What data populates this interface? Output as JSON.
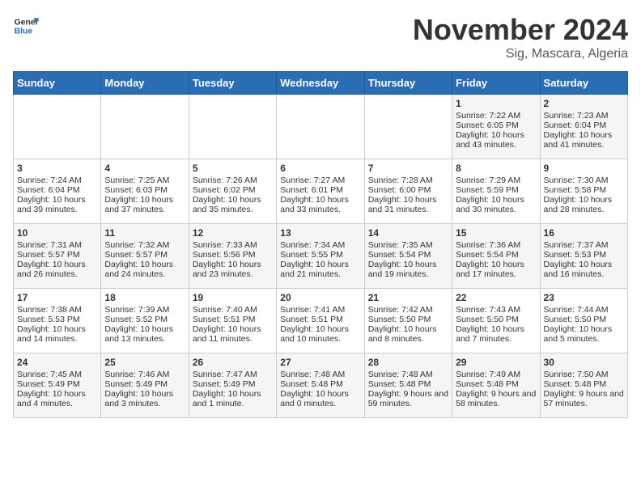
{
  "header": {
    "logo_general": "General",
    "logo_blue": "Blue",
    "month_title": "November 2024",
    "subtitle": "Sig, Mascara, Algeria"
  },
  "weekdays": [
    "Sunday",
    "Monday",
    "Tuesday",
    "Wednesday",
    "Thursday",
    "Friday",
    "Saturday"
  ],
  "weeks": [
    [
      {
        "day": "",
        "content": ""
      },
      {
        "day": "",
        "content": ""
      },
      {
        "day": "",
        "content": ""
      },
      {
        "day": "",
        "content": ""
      },
      {
        "day": "",
        "content": ""
      },
      {
        "day": "1",
        "content": "Sunrise: 7:22 AM\nSunset: 6:05 PM\nDaylight: 10 hours and 43 minutes."
      },
      {
        "day": "2",
        "content": "Sunrise: 7:23 AM\nSunset: 6:04 PM\nDaylight: 10 hours and 41 minutes."
      }
    ],
    [
      {
        "day": "3",
        "content": "Sunrise: 7:24 AM\nSunset: 6:04 PM\nDaylight: 10 hours and 39 minutes."
      },
      {
        "day": "4",
        "content": "Sunrise: 7:25 AM\nSunset: 6:03 PM\nDaylight: 10 hours and 37 minutes."
      },
      {
        "day": "5",
        "content": "Sunrise: 7:26 AM\nSunset: 6:02 PM\nDaylight: 10 hours and 35 minutes."
      },
      {
        "day": "6",
        "content": "Sunrise: 7:27 AM\nSunset: 6:01 PM\nDaylight: 10 hours and 33 minutes."
      },
      {
        "day": "7",
        "content": "Sunrise: 7:28 AM\nSunset: 6:00 PM\nDaylight: 10 hours and 31 minutes."
      },
      {
        "day": "8",
        "content": "Sunrise: 7:29 AM\nSunset: 5:59 PM\nDaylight: 10 hours and 30 minutes."
      },
      {
        "day": "9",
        "content": "Sunrise: 7:30 AM\nSunset: 5:58 PM\nDaylight: 10 hours and 28 minutes."
      }
    ],
    [
      {
        "day": "10",
        "content": "Sunrise: 7:31 AM\nSunset: 5:57 PM\nDaylight: 10 hours and 26 minutes."
      },
      {
        "day": "11",
        "content": "Sunrise: 7:32 AM\nSunset: 5:57 PM\nDaylight: 10 hours and 24 minutes."
      },
      {
        "day": "12",
        "content": "Sunrise: 7:33 AM\nSunset: 5:56 PM\nDaylight: 10 hours and 23 minutes."
      },
      {
        "day": "13",
        "content": "Sunrise: 7:34 AM\nSunset: 5:55 PM\nDaylight: 10 hours and 21 minutes."
      },
      {
        "day": "14",
        "content": "Sunrise: 7:35 AM\nSunset: 5:54 PM\nDaylight: 10 hours and 19 minutes."
      },
      {
        "day": "15",
        "content": "Sunrise: 7:36 AM\nSunset: 5:54 PM\nDaylight: 10 hours and 17 minutes."
      },
      {
        "day": "16",
        "content": "Sunrise: 7:37 AM\nSunset: 5:53 PM\nDaylight: 10 hours and 16 minutes."
      }
    ],
    [
      {
        "day": "17",
        "content": "Sunrise: 7:38 AM\nSunset: 5:53 PM\nDaylight: 10 hours and 14 minutes."
      },
      {
        "day": "18",
        "content": "Sunrise: 7:39 AM\nSunset: 5:52 PM\nDaylight: 10 hours and 13 minutes."
      },
      {
        "day": "19",
        "content": "Sunrise: 7:40 AM\nSunset: 5:51 PM\nDaylight: 10 hours and 11 minutes."
      },
      {
        "day": "20",
        "content": "Sunrise: 7:41 AM\nSunset: 5:51 PM\nDaylight: 10 hours and 10 minutes."
      },
      {
        "day": "21",
        "content": "Sunrise: 7:42 AM\nSunset: 5:50 PM\nDaylight: 10 hours and 8 minutes."
      },
      {
        "day": "22",
        "content": "Sunrise: 7:43 AM\nSunset: 5:50 PM\nDaylight: 10 hours and 7 minutes."
      },
      {
        "day": "23",
        "content": "Sunrise: 7:44 AM\nSunset: 5:50 PM\nDaylight: 10 hours and 5 minutes."
      }
    ],
    [
      {
        "day": "24",
        "content": "Sunrise: 7:45 AM\nSunset: 5:49 PM\nDaylight: 10 hours and 4 minutes."
      },
      {
        "day": "25",
        "content": "Sunrise: 7:46 AM\nSunset: 5:49 PM\nDaylight: 10 hours and 3 minutes."
      },
      {
        "day": "26",
        "content": "Sunrise: 7:47 AM\nSunset: 5:49 PM\nDaylight: 10 hours and 1 minute."
      },
      {
        "day": "27",
        "content": "Sunrise: 7:48 AM\nSunset: 5:48 PM\nDaylight: 10 hours and 0 minutes."
      },
      {
        "day": "28",
        "content": "Sunrise: 7:48 AM\nSunset: 5:48 PM\nDaylight: 9 hours and 59 minutes."
      },
      {
        "day": "29",
        "content": "Sunrise: 7:49 AM\nSunset: 5:48 PM\nDaylight: 9 hours and 58 minutes."
      },
      {
        "day": "30",
        "content": "Sunrise: 7:50 AM\nSunset: 5:48 PM\nDaylight: 9 hours and 57 minutes."
      }
    ]
  ]
}
